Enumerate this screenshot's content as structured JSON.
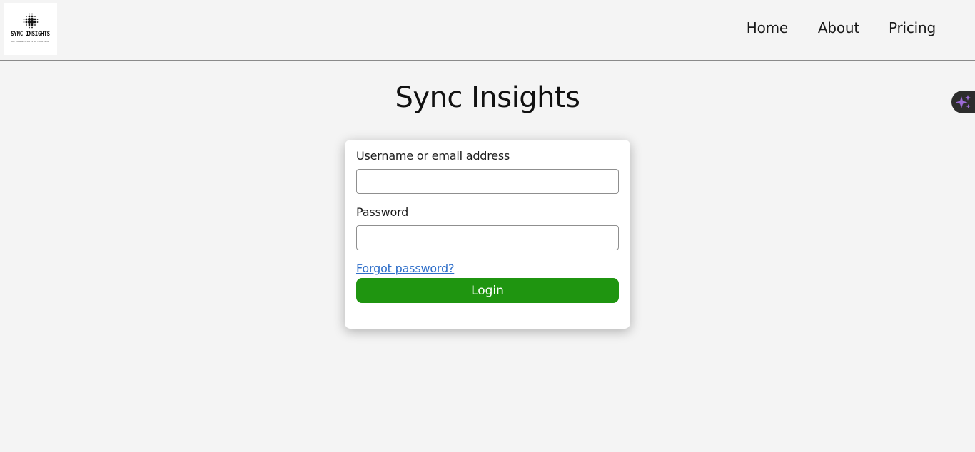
{
  "header": {
    "logo": {
      "title": "SYNC INSIGHTS",
      "tagline": "WE CONNECT DOTS OF YOUR DATA"
    },
    "nav": [
      {
        "label": "Home"
      },
      {
        "label": "About"
      },
      {
        "label": "Pricing"
      }
    ]
  },
  "main": {
    "title": "Sync Insights",
    "form": {
      "username_label": "Username or email address",
      "username_value": "",
      "password_label": "Password",
      "password_value": "",
      "forgot_link": "Forgot password?",
      "login_button": "Login"
    }
  },
  "floating_widget": {
    "icon": "sparkle-icon"
  },
  "colors": {
    "background": "#f4f4f4",
    "login_button": "#1f9510",
    "link": "#2d6ec9",
    "sparkle": "#9b6bd6"
  }
}
